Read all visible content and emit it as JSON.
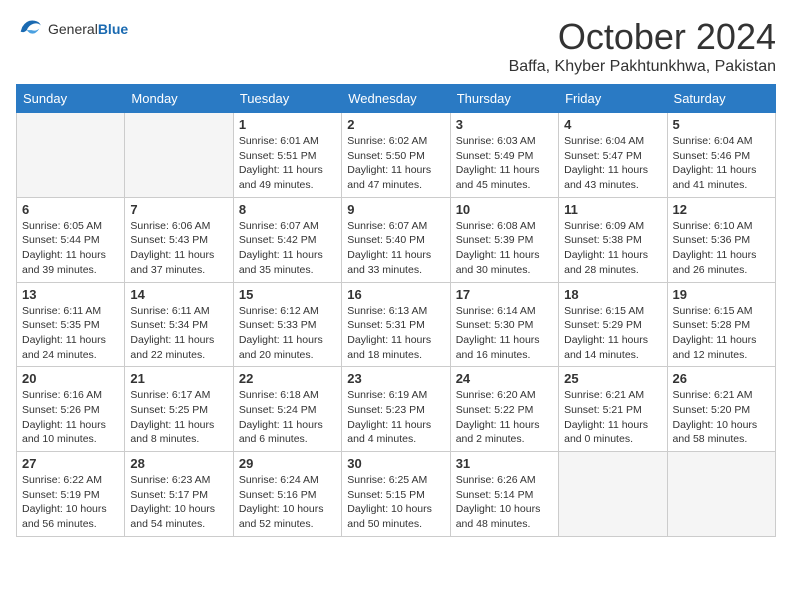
{
  "header": {
    "logo_general": "General",
    "logo_blue": "Blue",
    "month_title": "October 2024",
    "location": "Baffa, Khyber Pakhtunkhwa, Pakistan"
  },
  "weekdays": [
    "Sunday",
    "Monday",
    "Tuesday",
    "Wednesday",
    "Thursday",
    "Friday",
    "Saturday"
  ],
  "weeks": [
    [
      {
        "day": "",
        "sunrise": "",
        "sunset": "",
        "daylight": "",
        "empty": true
      },
      {
        "day": "",
        "sunrise": "",
        "sunset": "",
        "daylight": "",
        "empty": true
      },
      {
        "day": "1",
        "sunrise": "Sunrise: 6:01 AM",
        "sunset": "Sunset: 5:51 PM",
        "daylight": "Daylight: 11 hours and 49 minutes.",
        "empty": false
      },
      {
        "day": "2",
        "sunrise": "Sunrise: 6:02 AM",
        "sunset": "Sunset: 5:50 PM",
        "daylight": "Daylight: 11 hours and 47 minutes.",
        "empty": false
      },
      {
        "day": "3",
        "sunrise": "Sunrise: 6:03 AM",
        "sunset": "Sunset: 5:49 PM",
        "daylight": "Daylight: 11 hours and 45 minutes.",
        "empty": false
      },
      {
        "day": "4",
        "sunrise": "Sunrise: 6:04 AM",
        "sunset": "Sunset: 5:47 PM",
        "daylight": "Daylight: 11 hours and 43 minutes.",
        "empty": false
      },
      {
        "day": "5",
        "sunrise": "Sunrise: 6:04 AM",
        "sunset": "Sunset: 5:46 PM",
        "daylight": "Daylight: 11 hours and 41 minutes.",
        "empty": false
      }
    ],
    [
      {
        "day": "6",
        "sunrise": "Sunrise: 6:05 AM",
        "sunset": "Sunset: 5:44 PM",
        "daylight": "Daylight: 11 hours and 39 minutes.",
        "empty": false
      },
      {
        "day": "7",
        "sunrise": "Sunrise: 6:06 AM",
        "sunset": "Sunset: 5:43 PM",
        "daylight": "Daylight: 11 hours and 37 minutes.",
        "empty": false
      },
      {
        "day": "8",
        "sunrise": "Sunrise: 6:07 AM",
        "sunset": "Sunset: 5:42 PM",
        "daylight": "Daylight: 11 hours and 35 minutes.",
        "empty": false
      },
      {
        "day": "9",
        "sunrise": "Sunrise: 6:07 AM",
        "sunset": "Sunset: 5:40 PM",
        "daylight": "Daylight: 11 hours and 33 minutes.",
        "empty": false
      },
      {
        "day": "10",
        "sunrise": "Sunrise: 6:08 AM",
        "sunset": "Sunset: 5:39 PM",
        "daylight": "Daylight: 11 hours and 30 minutes.",
        "empty": false
      },
      {
        "day": "11",
        "sunrise": "Sunrise: 6:09 AM",
        "sunset": "Sunset: 5:38 PM",
        "daylight": "Daylight: 11 hours and 28 minutes.",
        "empty": false
      },
      {
        "day": "12",
        "sunrise": "Sunrise: 6:10 AM",
        "sunset": "Sunset: 5:36 PM",
        "daylight": "Daylight: 11 hours and 26 minutes.",
        "empty": false
      }
    ],
    [
      {
        "day": "13",
        "sunrise": "Sunrise: 6:11 AM",
        "sunset": "Sunset: 5:35 PM",
        "daylight": "Daylight: 11 hours and 24 minutes.",
        "empty": false
      },
      {
        "day": "14",
        "sunrise": "Sunrise: 6:11 AM",
        "sunset": "Sunset: 5:34 PM",
        "daylight": "Daylight: 11 hours and 22 minutes.",
        "empty": false
      },
      {
        "day": "15",
        "sunrise": "Sunrise: 6:12 AM",
        "sunset": "Sunset: 5:33 PM",
        "daylight": "Daylight: 11 hours and 20 minutes.",
        "empty": false
      },
      {
        "day": "16",
        "sunrise": "Sunrise: 6:13 AM",
        "sunset": "Sunset: 5:31 PM",
        "daylight": "Daylight: 11 hours and 18 minutes.",
        "empty": false
      },
      {
        "day": "17",
        "sunrise": "Sunrise: 6:14 AM",
        "sunset": "Sunset: 5:30 PM",
        "daylight": "Daylight: 11 hours and 16 minutes.",
        "empty": false
      },
      {
        "day": "18",
        "sunrise": "Sunrise: 6:15 AM",
        "sunset": "Sunset: 5:29 PM",
        "daylight": "Daylight: 11 hours and 14 minutes.",
        "empty": false
      },
      {
        "day": "19",
        "sunrise": "Sunrise: 6:15 AM",
        "sunset": "Sunset: 5:28 PM",
        "daylight": "Daylight: 11 hours and 12 minutes.",
        "empty": false
      }
    ],
    [
      {
        "day": "20",
        "sunrise": "Sunrise: 6:16 AM",
        "sunset": "Sunset: 5:26 PM",
        "daylight": "Daylight: 11 hours and 10 minutes.",
        "empty": false
      },
      {
        "day": "21",
        "sunrise": "Sunrise: 6:17 AM",
        "sunset": "Sunset: 5:25 PM",
        "daylight": "Daylight: 11 hours and 8 minutes.",
        "empty": false
      },
      {
        "day": "22",
        "sunrise": "Sunrise: 6:18 AM",
        "sunset": "Sunset: 5:24 PM",
        "daylight": "Daylight: 11 hours and 6 minutes.",
        "empty": false
      },
      {
        "day": "23",
        "sunrise": "Sunrise: 6:19 AM",
        "sunset": "Sunset: 5:23 PM",
        "daylight": "Daylight: 11 hours and 4 minutes.",
        "empty": false
      },
      {
        "day": "24",
        "sunrise": "Sunrise: 6:20 AM",
        "sunset": "Sunset: 5:22 PM",
        "daylight": "Daylight: 11 hours and 2 minutes.",
        "empty": false
      },
      {
        "day": "25",
        "sunrise": "Sunrise: 6:21 AM",
        "sunset": "Sunset: 5:21 PM",
        "daylight": "Daylight: 11 hours and 0 minutes.",
        "empty": false
      },
      {
        "day": "26",
        "sunrise": "Sunrise: 6:21 AM",
        "sunset": "Sunset: 5:20 PM",
        "daylight": "Daylight: 10 hours and 58 minutes.",
        "empty": false
      }
    ],
    [
      {
        "day": "27",
        "sunrise": "Sunrise: 6:22 AM",
        "sunset": "Sunset: 5:19 PM",
        "daylight": "Daylight: 10 hours and 56 minutes.",
        "empty": false
      },
      {
        "day": "28",
        "sunrise": "Sunrise: 6:23 AM",
        "sunset": "Sunset: 5:17 PM",
        "daylight": "Daylight: 10 hours and 54 minutes.",
        "empty": false
      },
      {
        "day": "29",
        "sunrise": "Sunrise: 6:24 AM",
        "sunset": "Sunset: 5:16 PM",
        "daylight": "Daylight: 10 hours and 52 minutes.",
        "empty": false
      },
      {
        "day": "30",
        "sunrise": "Sunrise: 6:25 AM",
        "sunset": "Sunset: 5:15 PM",
        "daylight": "Daylight: 10 hours and 50 minutes.",
        "empty": false
      },
      {
        "day": "31",
        "sunrise": "Sunrise: 6:26 AM",
        "sunset": "Sunset: 5:14 PM",
        "daylight": "Daylight: 10 hours and 48 minutes.",
        "empty": false
      },
      {
        "day": "",
        "sunrise": "",
        "sunset": "",
        "daylight": "",
        "empty": true
      },
      {
        "day": "",
        "sunrise": "",
        "sunset": "",
        "daylight": "",
        "empty": true
      }
    ]
  ]
}
